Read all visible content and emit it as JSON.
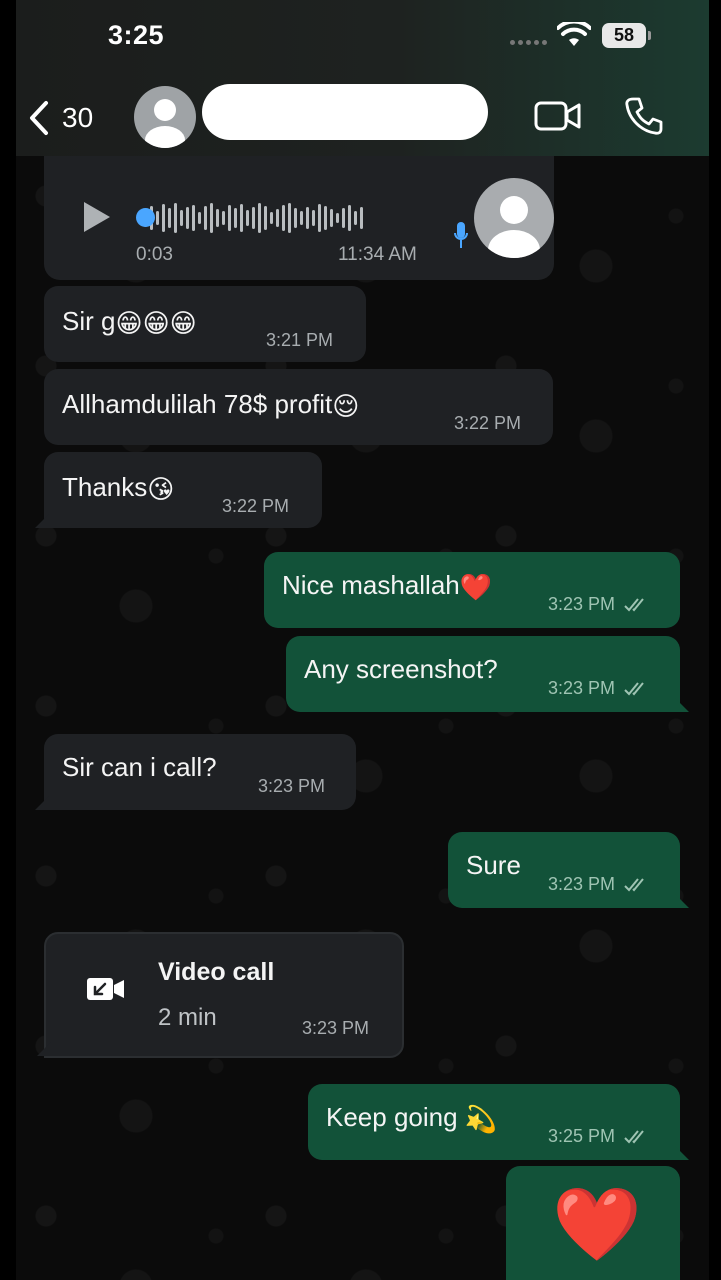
{
  "status_bar": {
    "time": "3:25",
    "battery": "58"
  },
  "header": {
    "back_count": "30"
  },
  "messages": [
    {
      "dir": "in",
      "type": "voice",
      "duration": "0:03",
      "time": "11:34 AM"
    },
    {
      "dir": "in",
      "text": "Sir g",
      "emoji": "😁😁😁",
      "time": "3:21 PM"
    },
    {
      "dir": "in",
      "text": "Allhamdulilah 78$ profit",
      "emoji": "😌",
      "time": "3:22 PM"
    },
    {
      "dir": "in",
      "text": "Thanks",
      "emoji": "😘",
      "time": "3:22 PM"
    },
    {
      "dir": "out",
      "text": "Nice mashallah",
      "emoji": "❤️",
      "time": "3:23 PM"
    },
    {
      "dir": "out",
      "text": "Any screenshot?",
      "time": "3:23 PM"
    },
    {
      "dir": "in",
      "text": "Sir can i call?",
      "time": "3:23 PM"
    },
    {
      "dir": "out",
      "text": "Sure",
      "time": "3:23 PM"
    },
    {
      "dir": "in",
      "type": "video_call",
      "title": "Video call",
      "subtitle": "2 min",
      "time": "3:23 PM"
    },
    {
      "dir": "out",
      "text": "Keep going ",
      "emoji": "💫",
      "time": "3:25 PM"
    },
    {
      "dir": "out",
      "type": "emoji_only",
      "emoji": "❤️"
    }
  ],
  "icons": {
    "back": "chevron-left-icon",
    "video": "video-camera-icon",
    "phone": "phone-icon",
    "play": "play-icon",
    "mic": "microphone-icon",
    "call": "incoming-video-call-icon",
    "ticks": "double-check-icon"
  },
  "colors": {
    "incoming_bubble": "#1f2124",
    "outgoing_bubble": "#125239",
    "accent": "#4aa6ff"
  }
}
